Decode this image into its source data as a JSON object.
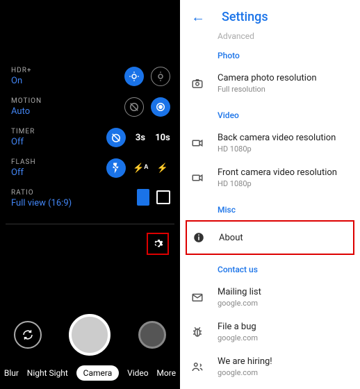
{
  "camera": {
    "hdr": {
      "label": "HDR+",
      "value": "On"
    },
    "motion": {
      "label": "MOTION",
      "value": "Auto"
    },
    "timer": {
      "label": "TIMER",
      "value": "Off",
      "opt1": "3s",
      "opt2": "10s"
    },
    "flash": {
      "label": "FLASH",
      "value": "Off",
      "opt1": "⚡ᴬ",
      "opt2": "⚡"
    },
    "ratio": {
      "label": "RATIO",
      "value": "Full view (16:9)"
    },
    "modes": {
      "blur": "Blur",
      "night": "Night Sight",
      "camera": "Camera",
      "video": "Video",
      "more": "More"
    }
  },
  "settings": {
    "title": "Settings",
    "prev": "Advanced",
    "sections": {
      "photo": {
        "header": "Photo",
        "res": {
          "title": "Camera photo resolution",
          "sub": "Full resolution"
        }
      },
      "video": {
        "header": "Video",
        "back": {
          "title": "Back camera video resolution",
          "sub": "HD 1080p"
        },
        "front": {
          "title": "Front camera video resolution",
          "sub": "HD 1080p"
        }
      },
      "misc": {
        "header": "Misc",
        "about": "About"
      },
      "contact": {
        "header": "Contact us",
        "mail": {
          "title": "Mailing list",
          "sub": "google.com"
        },
        "bug": {
          "title": "File a bug",
          "sub": "google.com"
        },
        "hiring": {
          "title": "We are hiring!",
          "sub": "google.com"
        }
      }
    }
  }
}
